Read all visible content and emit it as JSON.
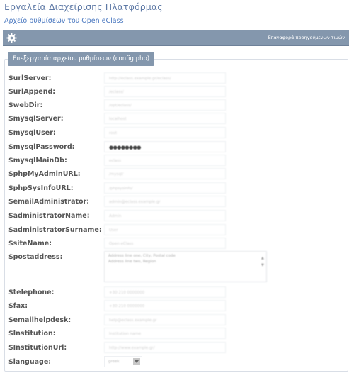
{
  "page": {
    "title": "Εργαλεία Διαχείρισης Πλατφόρμας",
    "breadcrumb": "Αρχείο ρυθμίσεων του Open eClass"
  },
  "toolbar": {
    "icon": "gear-icon",
    "restore_label": "Επαναφορά προηγούμενων τιμών"
  },
  "form": {
    "legend": "Επεξεργασία αρχείου ρυθμίσεων (config.php)",
    "fields": [
      {
        "label": "$urlServer:",
        "value": "http://eclass.example.gr/eclass/"
      },
      {
        "label": "$urlAppend:",
        "value": "/eclass/"
      },
      {
        "label": "$webDir:",
        "value": "/opt/eclass/"
      },
      {
        "label": "$mysqlServer:",
        "value": "localhost"
      },
      {
        "label": "$mysqlUser:",
        "value": "root"
      },
      {
        "label": "$mysqlPassword:",
        "value": "●●●●●●●●"
      },
      {
        "label": "$mysqlMainDb:",
        "value": "eclass"
      },
      {
        "label": "$phpMyAdminURL:",
        "value": "/mysql/"
      },
      {
        "label": "$phpSysInfoURL:",
        "value": "/phpsysinfo/"
      },
      {
        "label": "$emailAdministrator:",
        "value": "admin@eclass.example.gr"
      },
      {
        "label": "$administratorName:",
        "value": "Admin"
      },
      {
        "label": "$administratorSurname:",
        "value": "User"
      },
      {
        "label": "$siteName:",
        "value": "Open eClass"
      },
      {
        "label": "$postaddress:",
        "value": "Address line one, City, Postal code\nAddress line two, Region"
      },
      {
        "label": "$telephone:",
        "value": "+30 210 0000000"
      },
      {
        "label": "$fax:",
        "value": "+30 210 0000000"
      },
      {
        "label": "$emailhelpdesk:",
        "value": "help@eclass.example.gr"
      },
      {
        "label": "$Institution:",
        "value": "Institution name"
      },
      {
        "label": "$InstitutionUrl:",
        "value": "http://www.example.gr/"
      },
      {
        "label": "$language:",
        "value": "greek"
      }
    ]
  }
}
